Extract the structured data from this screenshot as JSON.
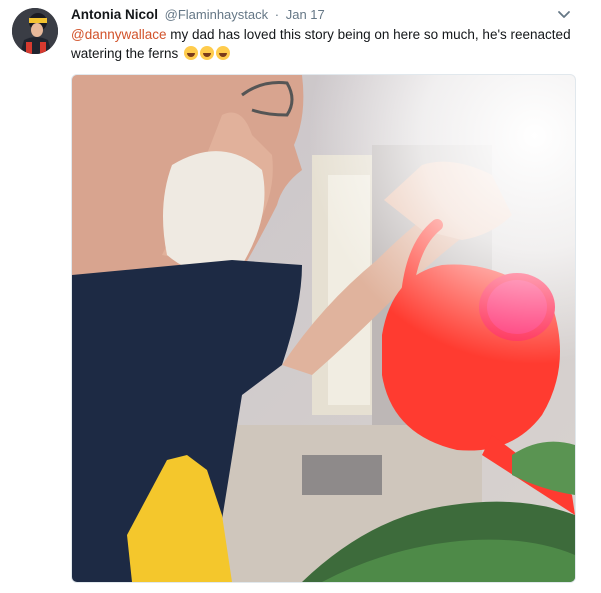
{
  "tweet": {
    "display_name": "Antonia Nicol",
    "handle": "@Flaminhaystack",
    "separator": "·",
    "timestamp": "Jan 17",
    "mention": "@dannywallace",
    "body_text": " my dad has loved this story being on here so much, he's reenacted watering the ferns",
    "emojis": [
      "face-with-tears-of-joy",
      "face-with-tears-of-joy",
      "face-with-tears-of-joy"
    ]
  },
  "icons": {
    "caret": "chevron-down-icon"
  },
  "colors": {
    "mention": "#d2532b",
    "secondary_text": "#657786",
    "watering_can": "#ff3b30"
  }
}
